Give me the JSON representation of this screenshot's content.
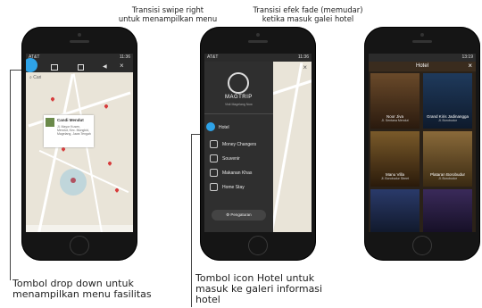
{
  "captions": {
    "swipe_line1": "Transisi swipe right",
    "swipe_line2": "untuk menampilkan menu",
    "fade_line1": "Transisi efek fade (memudar)",
    "fade_line2": "ketika masuk galei hotel",
    "dropdown_line1": "Tombol drop down untuk",
    "dropdown_line2": "menampilkan menu fasilitas",
    "hotel_line1": "Tombol icon Hotel untuk",
    "hotel_line2": "masuk ke galeri informasi",
    "hotel_line3": "hotel"
  },
  "phone1": {
    "status_left": "AT&T",
    "status_time": "11:36",
    "search_placeholder": "Cari",
    "popup_title": "Candi Mendut",
    "popup_body": "Jl. Mayor Kusen, Mendut, Kec. Mungkid, Magelang, Jawa Tengah"
  },
  "phone2": {
    "status_left": "AT&T",
    "status_time": "11:36",
    "brand": "MAGTRIP",
    "tagline": "Visit Magelang Now",
    "menu": [
      {
        "label": "Hotel",
        "icon": "hotel-icon"
      },
      {
        "label": "Money Changers",
        "icon": "money-icon"
      },
      {
        "label": "Souvenir",
        "icon": "gift-icon"
      },
      {
        "label": "Makanan Khas",
        "icon": "food-icon"
      },
      {
        "label": "Home Stay",
        "icon": "home-icon"
      }
    ],
    "settings_label": "Pengaturan"
  },
  "phone3": {
    "status_time": "13:19",
    "title": "Hotel",
    "hotels": [
      {
        "name": "Noor Jiva",
        "addr": "Jl. Sentana Mendut"
      },
      {
        "name": "Grand Kiris Jadinangga",
        "addr": "Jl. Borobudur"
      },
      {
        "name": "Manu Villa",
        "addr": "Jl. Borobudur Street"
      },
      {
        "name": "Plataran Borobudur",
        "addr": "Jl. Borobudur"
      },
      {
        "name": "",
        "addr": ""
      },
      {
        "name": "",
        "addr": ""
      }
    ]
  },
  "colors": {
    "accent": "#2ea3e8",
    "menu_bg": "#2f2f2f",
    "pin": "#d73c3c"
  }
}
